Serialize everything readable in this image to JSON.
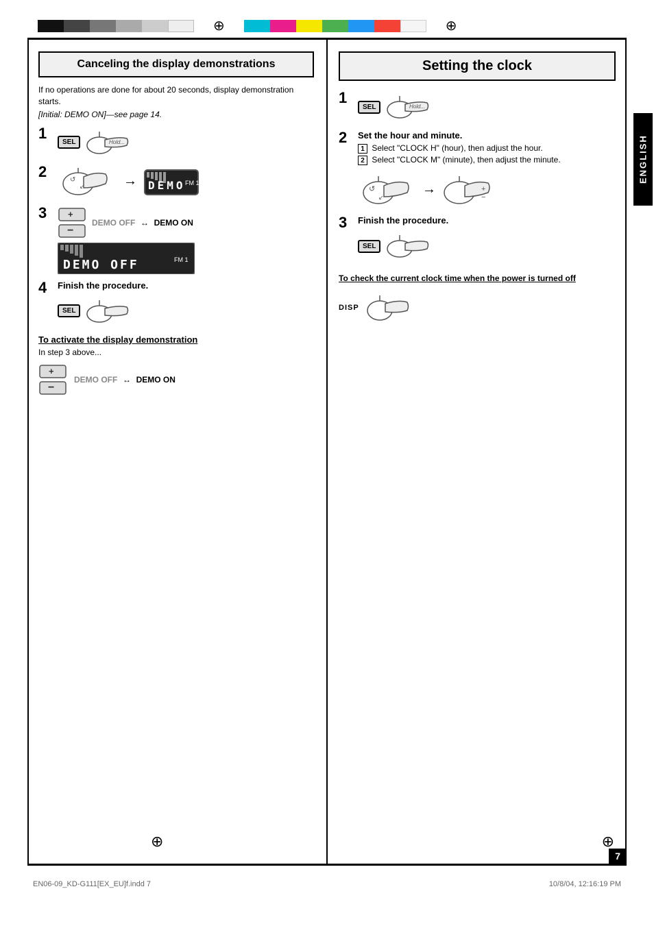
{
  "page": {
    "number": "7",
    "footer_left": "EN06-09_KD-G111[EX_EU]f.indd  7",
    "footer_right": "10/8/04, 12:16:19 PM"
  },
  "left_section": {
    "title": "Canceling the display demonstrations",
    "desc1": "If no operations are done for about 20 seconds, display demonstration starts.",
    "desc2": "[Initial: DEMO ON]—see page 14.",
    "step1_label": "1",
    "step2_label": "2",
    "step3_label": "3",
    "step3_demo_off": "DEMO OFF",
    "step3_arrow": "↔",
    "step3_demo_on": "DEMO ON",
    "step4_label": "4",
    "step4_text": "Finish the procedure.",
    "display1_text": "DEMO",
    "display1_fm": "FM 1",
    "display2_text": "DEMO  OFF",
    "display2_fm": "FM 1",
    "hold_label": "Hold...",
    "sub_heading": "To activate the display demonstration",
    "sub_desc": "In step 3 above...",
    "sub_demo_off": "DEMO OFF",
    "sub_arrow": "↔",
    "sub_demo_on": "DEMO ON"
  },
  "right_section": {
    "title": "Setting the clock",
    "step1_label": "1",
    "step2_label": "2",
    "step2_text": "Set the hour and minute.",
    "step2_sub1": "Select \"CLOCK H\" (hour), then adjust the hour.",
    "step2_sub2": "Select \"CLOCK M\" (minute), then adjust the minute.",
    "step3_label": "3",
    "step3_text": "Finish the procedure.",
    "hold_label": "Hold...",
    "clock_check_heading": "To check the current clock time when the power is turned off",
    "disp_label": "DISP",
    "english_label": "ENGLISH"
  }
}
